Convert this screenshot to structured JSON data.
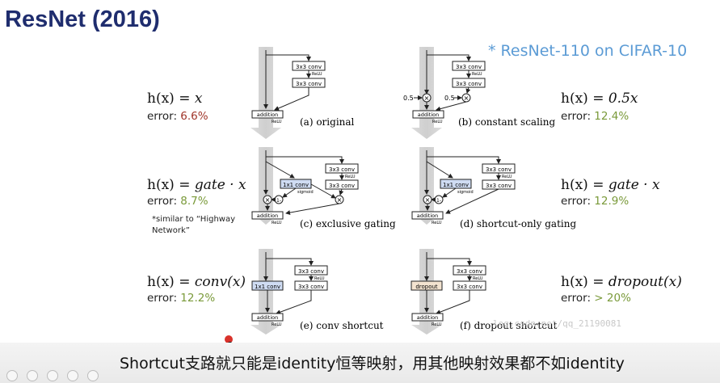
{
  "slide": {
    "title": "ResNet (2016)",
    "note": "* ResNet-110 on CIFAR-10",
    "footnote": "*similar to “Highway Network”",
    "caption": "Shortcut支路就只能是identity恒等映射，用其他映射效果都不如identity",
    "watermark": "log.csdn.net/qq_21190081"
  },
  "panels": [
    {
      "label": "(a) original",
      "formula_lhs": "h(x) = ",
      "formula_rhs": "x",
      "error_label": "error: ",
      "error_value": "6.6%",
      "error_color": "#a0352a"
    },
    {
      "label": "(b) constant scaling",
      "formula_lhs": "h(x) = ",
      "formula_rhs": "0.5x",
      "error_label": "error: ",
      "error_value": "12.4%",
      "error_color": "#7a9a3a",
      "scale_label": "0.5"
    },
    {
      "label": "(c) exclusive gating",
      "formula_lhs": "h(x) = ",
      "formula_rhs": "gate · x",
      "error_label": "error: ",
      "error_value": "8.7%",
      "error_color": "#7a9a3a"
    },
    {
      "label": "(d) shortcut-only gating",
      "formula_lhs": "h(x) = ",
      "formula_rhs": "gate · x",
      "error_label": "error: ",
      "error_value": "12.9%",
      "error_color": "#7a9a3a"
    },
    {
      "label": "(e) conv shortcut",
      "formula_lhs": "h(x) = ",
      "formula_rhs": "conv(x)",
      "error_label": "error: ",
      "error_value": "12.2%",
      "error_color": "#7a9a3a"
    },
    {
      "label": "(f) dropout shortcut",
      "formula_lhs": "h(x) = ",
      "formula_rhs": "dropout(x)",
      "error_label": "error: ",
      "error_value": "> 20%",
      "error_color": "#7a9a3a"
    }
  ],
  "blocks": {
    "conv3": "3x3 conv",
    "relu": "ReLU",
    "addition": "addition",
    "conv1": "1x1 conv",
    "sigmoid": "sigmoid",
    "dropout": "dropout",
    "one_minus": "1-"
  },
  "colors": {
    "title": "#1f2d6e",
    "note": "#5b9bd5",
    "gate_box": "#cfdcf3",
    "dropout_box": "#f3e3d0",
    "highlight_dot": "#d9322b"
  }
}
